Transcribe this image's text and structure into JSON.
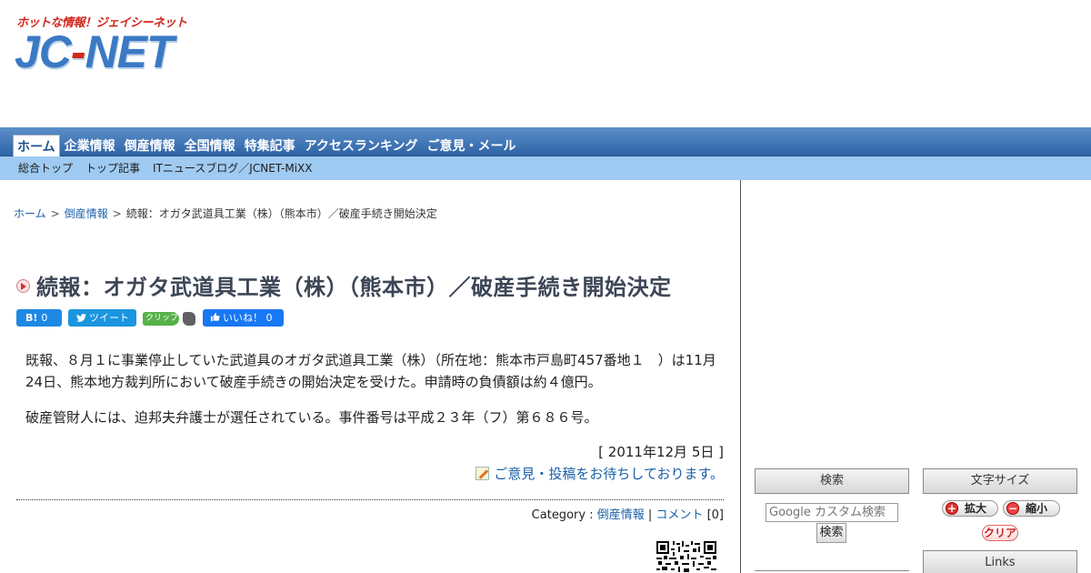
{
  "header": {
    "tagline": "ホットな情報！ジェイシーネット",
    "logo_main_a": "JC",
    "logo_main_dash": "-",
    "logo_main_b": "NET"
  },
  "nav": {
    "items": [
      {
        "label": "ホーム"
      },
      {
        "label": "企業情報"
      },
      {
        "label": "倒産情報"
      },
      {
        "label": "全国情報"
      },
      {
        "label": "特集記事"
      },
      {
        "label": "アクセスランキング"
      },
      {
        "label": "ご意見・メール"
      }
    ]
  },
  "subnav": {
    "items": [
      {
        "label": "総合トップ"
      },
      {
        "label": "トップ記事"
      },
      {
        "label": "ITニュースブログ／JCNET-MiXX"
      }
    ]
  },
  "breadcrumb": {
    "home": "ホーム",
    "sep": ">",
    "category": "倒産情報",
    "current": "続報：オガタ武道具工業（株）（熊本市）／破産手続き開始決定"
  },
  "article": {
    "title": "続報：オガタ武道具工業（株）（熊本市）／破産手続き開始決定",
    "paragraph1": "既報、８月１に事業停止していた武道具のオガタ武道具工業（株）（所在地：熊本市戸島町457番地１　）は11月24日、熊本地方裁判所において破産手続きの開始決定を受けた。申請時の負債額は約４億円。",
    "paragraph2": "破産管財人には、迫邦夫弁護士が選任されている。事件番号は平成２３年（フ）第６８６号。",
    "date": "[ 2011年12月 5日 ]",
    "opinion": "ご意見・投稿をお待ちしております。"
  },
  "social": {
    "hatena_label": "B!",
    "hatena_count": "0",
    "tweet_label": "ツイート",
    "clip_label": "クリップ",
    "like_label": "いいね！ 0"
  },
  "meta": {
    "category_label": "Category",
    "category_sep": ":",
    "category_value": "倒産情報",
    "pipe": "|",
    "comment_label": "コメント",
    "comment_count": "[0]"
  },
  "sidebar": {
    "search_title": "検索",
    "search_placeholder": "Google カスタム検索",
    "search_button": "検索",
    "font_size_title": "文字サイズ",
    "zoom_in": "拡大",
    "zoom_out": "縮小",
    "zoom_clear": "クリア",
    "links_title": "Links"
  },
  "colors": {
    "nav_blue": "#2e64a6",
    "subnav_blue": "#9fcaf1",
    "link_blue": "#1a5fa8",
    "logo_blue": "#3b79c4",
    "logo_red": "#d3281e"
  }
}
